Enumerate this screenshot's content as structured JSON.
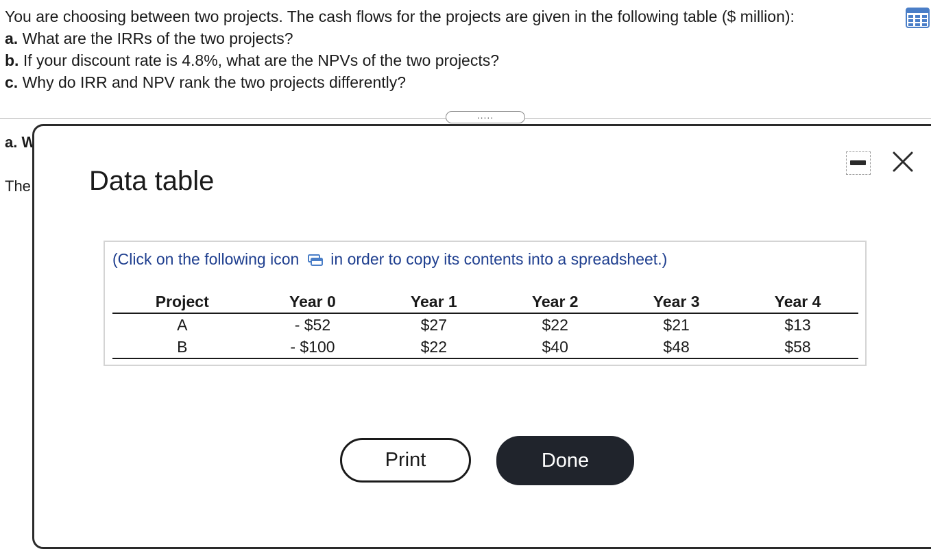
{
  "question": {
    "intro": "You are choosing between two projects. The cash flows for the projects are given in the following table ($ million):",
    "parts": [
      {
        "label": "a.",
        "text": "What are the IRRs of the two projects?"
      },
      {
        "label": "b.",
        "text": "If your discount rate is 4.8%, what are the NPVs of the two projects?"
      },
      {
        "label": "c.",
        "text": "Why do IRR and NPV rank the two projects differently?"
      }
    ]
  },
  "expander": {
    "label": "....."
  },
  "background": {
    "line1": "a. W",
    "line2": "The"
  },
  "modal": {
    "title": "Data table",
    "instruction_before": "(Click on the following icon",
    "instruction_after": "in order to copy its contents into a spreadsheet.)",
    "columns": [
      "Project",
      "Year 0",
      "Year 1",
      "Year 2",
      "Year 3",
      "Year 4"
    ],
    "rows": [
      [
        "A",
        "- $52",
        "$27",
        "$22",
        "$21",
        "$13"
      ],
      [
        "B",
        "- $100",
        "$22",
        "$40",
        "$48",
        "$58"
      ]
    ],
    "print_label": "Print",
    "done_label": "Done"
  },
  "colors": {
    "accent_blue": "#1f3f8f",
    "icon_blue": "#4a7ec7",
    "done_button": "#20242c"
  }
}
